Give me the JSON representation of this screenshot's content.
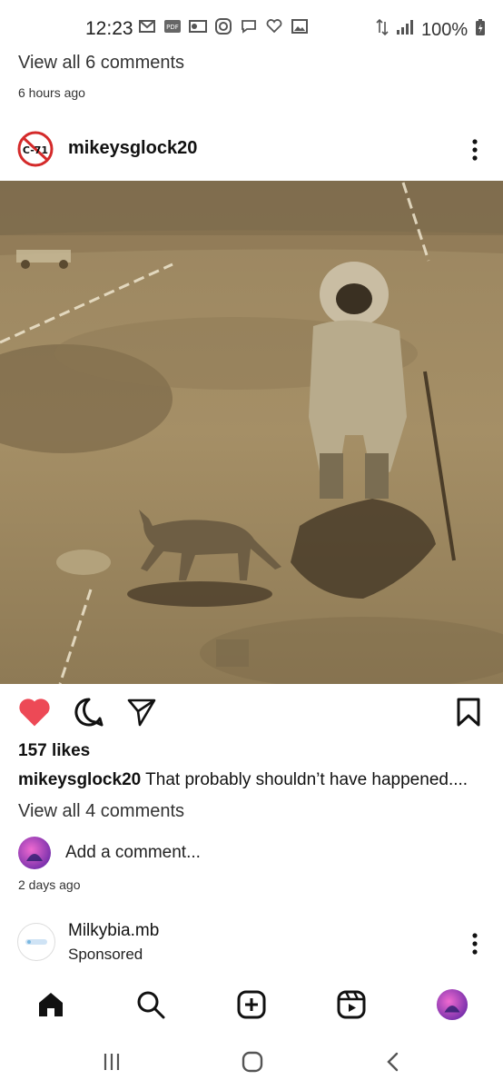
{
  "status_bar": {
    "time": "12:23",
    "battery": "100%",
    "icons": [
      "mail-icon",
      "pdf-icon",
      "outlook-icon",
      "instagram-icon",
      "message-icon",
      "heart-notification-icon",
      "gallery-icon"
    ]
  },
  "previous_post": {
    "view_comments": "View all 6 comments",
    "time": "6 hours ago"
  },
  "post": {
    "username": "mikeysglock20",
    "avatar_text": "C-71",
    "likes": "157 likes",
    "caption_user": "mikeysglock20",
    "caption_text": "That probably shouldn’t have happened....",
    "view_comments": "View all 4 comments",
    "add_comment": "Add a comment...",
    "time": "2 days ago",
    "liked": true,
    "like_color": "#ed4956"
  },
  "sponsored_post": {
    "username": "Milkybia.mb",
    "label": "Sponsored"
  },
  "bottom_nav": [
    "home-icon",
    "search-icon",
    "create-icon",
    "reels-icon",
    "profile-icon"
  ],
  "system_nav": [
    "recents-icon",
    "home-circle-icon",
    "back-icon"
  ]
}
